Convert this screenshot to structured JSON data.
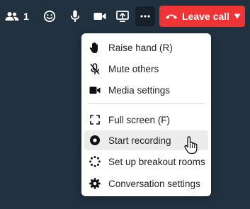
{
  "toolbar": {
    "participants_count": "1",
    "leave_call_label": "Leave call"
  },
  "menu": {
    "items": [
      {
        "label": "Raise hand (R)",
        "icon": "hand-icon"
      },
      {
        "label": "Mute others",
        "icon": "mic-off-icon"
      },
      {
        "label": "Media settings",
        "icon": "video-camera-icon"
      },
      {
        "label": "Full screen (F)",
        "icon": "fullscreen-icon"
      },
      {
        "label": "Start recording",
        "icon": "record-icon"
      },
      {
        "label": "Set up breakout rooms",
        "icon": "breakout-rooms-icon"
      },
      {
        "label": "Conversation settings",
        "icon": "gear-icon"
      }
    ]
  },
  "colors": {
    "background": "#223140",
    "leave_button": "#ee3434",
    "menu_background": "#ffffff",
    "hover_background": "#ececec"
  }
}
